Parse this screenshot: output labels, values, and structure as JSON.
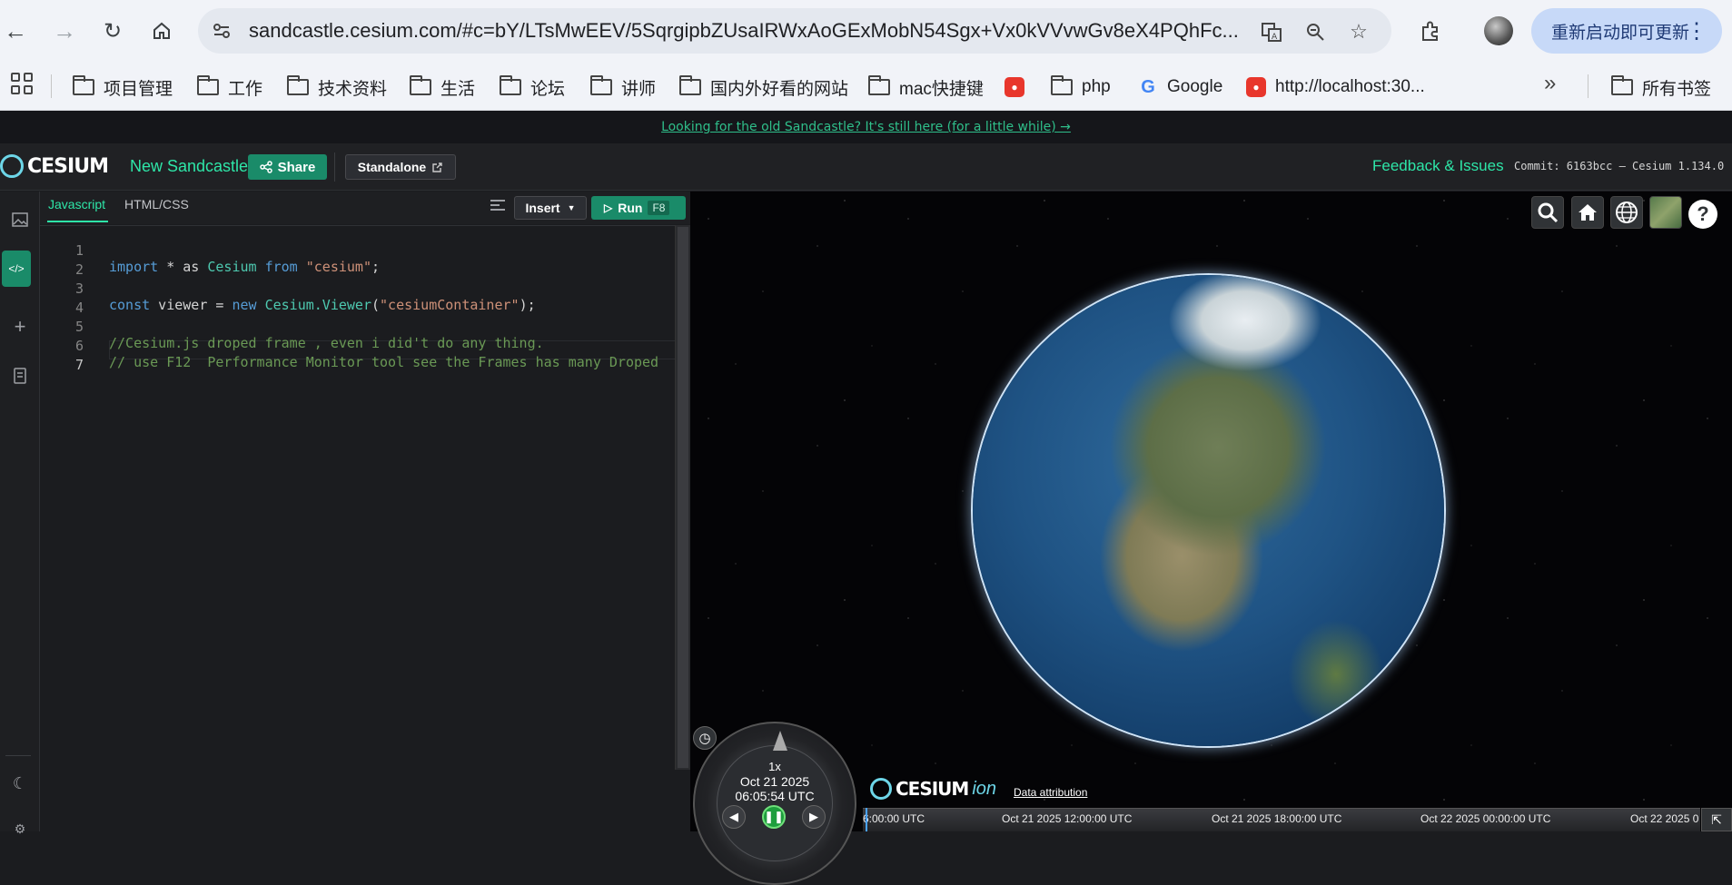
{
  "browser": {
    "url": "sandcastle.cesium.com/#c=bY/LTsMwEEV/5SqrgipbZUsaIRWxAoGExMobN54Sgx+Vx0kVVvwGv8eX4PQhFc...",
    "update_label": "重新启动即可更新",
    "bookmarks": [
      {
        "label": "项目管理",
        "icon": "folder-icon"
      },
      {
        "label": "工作",
        "icon": "folder-icon"
      },
      {
        "label": "技术资料",
        "icon": "folder-icon"
      },
      {
        "label": "生活",
        "icon": "folder-icon"
      },
      {
        "label": "论坛",
        "icon": "folder-icon"
      },
      {
        "label": "讲师",
        "icon": "folder-icon"
      },
      {
        "label": "国内外好看的网站",
        "icon": "folder-icon"
      },
      {
        "label": "mac快捷键",
        "icon": "folder-icon"
      },
      {
        "label": "php",
        "icon": "folder-icon"
      },
      {
        "label": "Google",
        "icon": "google-icon"
      },
      {
        "label": "http://localhost:30...",
        "icon": "wechat-icon"
      }
    ],
    "all_bookmarks_label": "所有书签"
  },
  "banner": {
    "text": "Looking for the old Sandcastle? It's still here (for a little while) →"
  },
  "header": {
    "logo": "CESIUM",
    "title": "New Sandcastle",
    "share_label": "Share",
    "standalone_label": "Standalone",
    "feedback_label": "Feedback & Issues",
    "commit_text": "Commit: 6163bcc – Cesium 1.134.0"
  },
  "editor": {
    "tabs": [
      "Javascript",
      "HTML/CSS"
    ],
    "insert_label": "Insert",
    "run_label": "Run",
    "run_shortcut": "F8",
    "line_numbers": [
      "1",
      "2",
      "3",
      "4",
      "5",
      "6",
      "7"
    ],
    "lines": {
      "l1": {
        "kw1": "import",
        "t1": " * as ",
        "id1": "Cesium",
        "kw2": " from ",
        "str1": "\"cesium\"",
        "t2": ";"
      },
      "l3": {
        "kw1": "const",
        "t1": " viewer = ",
        "kw2": "new",
        "t2": " ",
        "id1": "Cesium.Viewer",
        "t3": "(",
        "str1": "\"cesiumContainer\"",
        "t4": ");"
      },
      "l5": "//Cesium.js droped frame , even i did't do any thing.",
      "l6": "// use F12  Performance Monitor tool see the Frames has many Droped"
    }
  },
  "viewer": {
    "help_label": "?",
    "animation": {
      "speed": "1x",
      "date": "Oct 21 2025",
      "time": "06:05:54 UTC"
    },
    "credit_logo": "CESIUM",
    "credit_ion": "ion",
    "data_attribution": "Data attribution",
    "timeline_labels": [
      "6:00:00 UTC",
      "Oct 21 2025 12:00:00 UTC",
      "Oct 21 2025 18:00:00 UTC",
      "Oct 22 2025 00:00:00 UTC",
      "Oct 22 2025 0"
    ]
  }
}
